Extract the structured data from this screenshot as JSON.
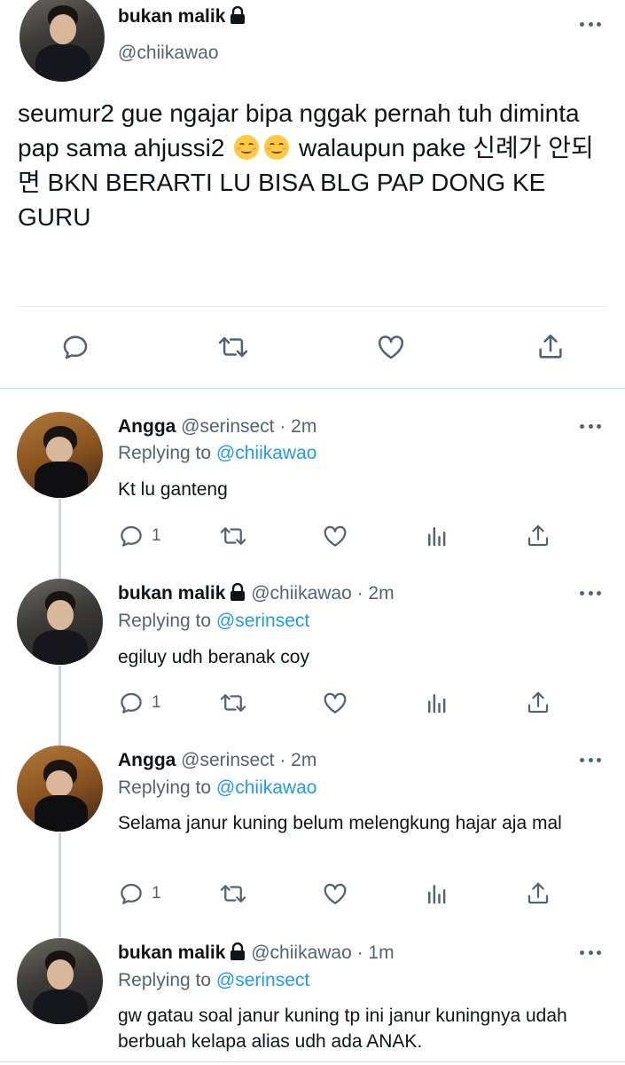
{
  "main_tweet": {
    "author_name": "bukan malik",
    "author_handle": "@chiikawao",
    "text_part1": "seumur2 gue ngajar bipa nggak pernah tuh diminta pap sama ahjussi2",
    "text_part2": "walaupun pake 신례가 안되면 BKN BERARTI LU BISA BLG PAP DONG KE GURU",
    "emoji": [
      "smiling-face-emoji",
      "smiling-face-emoji"
    ],
    "actions": [
      "reply-icon",
      "retweet-icon",
      "like-icon",
      "share-icon"
    ]
  },
  "replies": [
    {
      "author_name": "Angga",
      "author_handle": "@serinsect · 2m",
      "replying_label": "Replying to ",
      "replying_to": "@chiikawao",
      "text": "Kt lu ganteng",
      "reply_count": "1"
    },
    {
      "author_name": "bukan malik",
      "author_handle": "@chiikawao · 2m",
      "replying_label": "Replying to ",
      "replying_to": "@serinsect",
      "text": "egiluy udh beranak coy",
      "reply_count": "1"
    },
    {
      "author_name": "Angga",
      "author_handle": "@serinsect · 2m",
      "replying_label": "Replying to ",
      "replying_to": "@chiikawao",
      "text": "Selama janur kuning belum melengkung hajar aja mal",
      "reply_count": "1"
    },
    {
      "author_name": "bukan malik",
      "author_handle": "@chiikawao · 1m",
      "replying_label": "Replying to ",
      "replying_to": "@serinsect",
      "text": "gw gatau soal janur kuning tp ini janur kuningnya udah berbuah kelapa  alias udh ada ANAK."
    }
  ],
  "colors": {
    "text": "#0f1419",
    "secondary": "#536471",
    "link": "#1d9bf0",
    "divider": "#cfd9de"
  }
}
